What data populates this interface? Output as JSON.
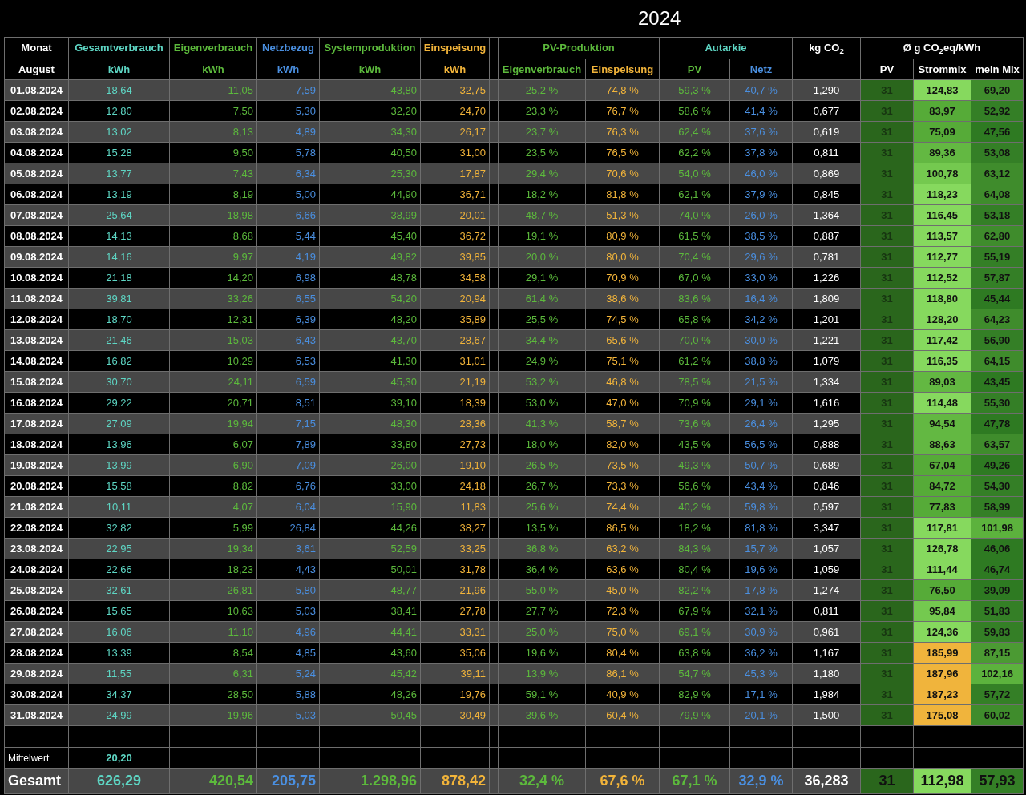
{
  "title": "2024",
  "header": [
    {
      "label": "Monat",
      "color": "#ffffff",
      "kind": "energy",
      "sub": [
        {
          "label": "August",
          "color": "#ffffff"
        }
      ]
    },
    {
      "label": "Gesamtverbrauch",
      "color": "#5ed6c4",
      "kind": "energy",
      "sub": [
        {
          "label": "kWh",
          "color": "#5ed6c4"
        }
      ]
    },
    {
      "label": "Eigenverbrauch",
      "color": "#5cb93c",
      "kind": "energy",
      "sub": [
        {
          "label": "kWh",
          "color": "#5cb93c"
        }
      ]
    },
    {
      "label": "Netzbezug",
      "color": "#4a8fe0",
      "kind": "energy",
      "sub": [
        {
          "label": "kWh",
          "color": "#4a8fe0"
        }
      ]
    },
    {
      "label": "Systemproduktion",
      "color": "#5cb93c",
      "kind": "energy",
      "sub": [
        {
          "label": "kWh",
          "color": "#5cb93c"
        }
      ]
    },
    {
      "label": "Einspeisung",
      "color": "#f2b43a",
      "kind": "energy",
      "sub": [
        {
          "label": "kWh",
          "color": "#f2b43a"
        }
      ]
    },
    {
      "label": "PV-Produktion",
      "color": "#5cb93c",
      "kind": "share",
      "sub": [
        {
          "label": "Eigenverbrauch",
          "color": "#5cb93c"
        },
        {
          "label": "Einspeisung",
          "color": "#f2b43a"
        }
      ]
    },
    {
      "label": "Autarkie",
      "color": "#5ed6c4",
      "kind": "share",
      "sub": [
        {
          "label": "PV",
          "color": "#5cb93c"
        },
        {
          "label": "Netz",
          "color": "#4a8fe0"
        }
      ]
    },
    {
      "label": "kg CO$_{2}$",
      "color": "#ffffff",
      "kind": "co2"
    },
    {
      "label": "Ø g CO$_{2}$eq/kWh",
      "color": "#ffffff",
      "kind": "intensity",
      "sub": [
        {
          "label": "PV",
          "color": "#ffffff"
        },
        {
          "label": "Strommix",
          "color": "#ffffff"
        },
        {
          "label": "mein Mix",
          "color": "#ffffff"
        }
      ]
    }
  ],
  "rows": [
    {
      "date": "01.08.2024",
      "values": [
        "18,64",
        "11,05",
        "7,59",
        "43,80",
        "32,75",
        "25,2 %",
        "74,8 %",
        "59,3 %",
        "40,7 %",
        "1,290"
      ],
      "mix": [
        {
          "text": "31",
          "color": "#2a661c"
        },
        {
          "text": "124,83",
          "color": "#86d95e"
        },
        {
          "text": "69,20",
          "color": "#3f8c2c"
        }
      ]
    },
    {
      "date": "02.08.2024",
      "values": [
        "12,80",
        "7,50",
        "5,30",
        "32,20",
        "24,70",
        "23,3 %",
        "76,7 %",
        "58,6 %",
        "41,4 %",
        "0,677"
      ],
      "mix": [
        {
          "text": "31",
          "color": "#2a661c"
        },
        {
          "text": "83,97",
          "color": "#56ab38"
        },
        {
          "text": "52,92",
          "color": "#347f26"
        }
      ]
    },
    {
      "date": "03.08.2024",
      "values": [
        "13,02",
        "8,13",
        "4,89",
        "34,30",
        "26,17",
        "23,7 %",
        "76,3 %",
        "62,4 %",
        "37,6 %",
        "0,619"
      ],
      "mix": [
        {
          "text": "31",
          "color": "#2a661c"
        },
        {
          "text": "75,09",
          "color": "#56ab38"
        },
        {
          "text": "47,56",
          "color": "#2e7a22"
        }
      ]
    },
    {
      "date": "04.08.2024",
      "values": [
        "15,28",
        "9,50",
        "5,78",
        "40,50",
        "31,00",
        "23,5 %",
        "76,5 %",
        "62,2 %",
        "37,8 %",
        "0,811"
      ],
      "mix": [
        {
          "text": "31",
          "color": "#2a661c"
        },
        {
          "text": "89,36",
          "color": "#63b842"
        },
        {
          "text": "53,08",
          "color": "#347f26"
        }
      ]
    },
    {
      "date": "05.08.2024",
      "values": [
        "13,77",
        "7,43",
        "6,34",
        "25,30",
        "17,87",
        "29,4 %",
        "70,6 %",
        "54,0 %",
        "46,0 %",
        "0,869"
      ],
      "mix": [
        {
          "text": "31",
          "color": "#2a661c"
        },
        {
          "text": "100,78",
          "color": "#74c94f"
        },
        {
          "text": "63,12",
          "color": "#3f8c2c"
        }
      ]
    },
    {
      "date": "06.08.2024",
      "values": [
        "13,19",
        "8,19",
        "5,00",
        "44,90",
        "36,71",
        "18,2 %",
        "81,8 %",
        "62,1 %",
        "37,9 %",
        "0,845"
      ],
      "mix": [
        {
          "text": "31",
          "color": "#2a661c"
        },
        {
          "text": "118,23",
          "color": "#86d95e"
        },
        {
          "text": "64,08",
          "color": "#3f8c2c"
        }
      ]
    },
    {
      "date": "07.08.2024",
      "values": [
        "25,64",
        "18,98",
        "6,66",
        "38,99",
        "20,01",
        "48,7 %",
        "51,3 %",
        "74,0 %",
        "26,0 %",
        "1,364"
      ],
      "mix": [
        {
          "text": "31",
          "color": "#2a661c"
        },
        {
          "text": "116,45",
          "color": "#86d95e"
        },
        {
          "text": "53,18",
          "color": "#347f26"
        }
      ]
    },
    {
      "date": "08.08.2024",
      "values": [
        "14,13",
        "8,68",
        "5,44",
        "45,40",
        "36,72",
        "19,1 %",
        "80,9 %",
        "61,5 %",
        "38,5 %",
        "0,887"
      ],
      "mix": [
        {
          "text": "31",
          "color": "#2a661c"
        },
        {
          "text": "113,57",
          "color": "#86d95e"
        },
        {
          "text": "62,80",
          "color": "#3f8c2c"
        }
      ]
    },
    {
      "date": "09.08.2024",
      "values": [
        "14,16",
        "9,97",
        "4,19",
        "49,82",
        "39,85",
        "20,0 %",
        "80,0 %",
        "70,4 %",
        "29,6 %",
        "0,781"
      ],
      "mix": [
        {
          "text": "31",
          "color": "#2a661c"
        },
        {
          "text": "112,77",
          "color": "#86d95e"
        },
        {
          "text": "55,19",
          "color": "#347f26"
        }
      ]
    },
    {
      "date": "10.08.2024",
      "values": [
        "21,18",
        "14,20",
        "6,98",
        "48,78",
        "34,58",
        "29,1 %",
        "70,9 %",
        "67,0 %",
        "33,0 %",
        "1,226"
      ],
      "mix": [
        {
          "text": "31",
          "color": "#2a661c"
        },
        {
          "text": "112,52",
          "color": "#86d95e"
        },
        {
          "text": "57,87",
          "color": "#347f26"
        }
      ]
    },
    {
      "date": "11.08.2024",
      "values": [
        "39,81",
        "33,26",
        "6,55",
        "54,20",
        "20,94",
        "61,4 %",
        "38,6 %",
        "83,6 %",
        "16,4 %",
        "1,809"
      ],
      "mix": [
        {
          "text": "31",
          "color": "#2a661c"
        },
        {
          "text": "118,80",
          "color": "#86d95e"
        },
        {
          "text": "45,44",
          "color": "#2e7a22"
        }
      ]
    },
    {
      "date": "12.08.2024",
      "values": [
        "18,70",
        "12,31",
        "6,39",
        "48,20",
        "35,89",
        "25,5 %",
        "74,5 %",
        "65,8 %",
        "34,2 %",
        "1,201"
      ],
      "mix": [
        {
          "text": "31",
          "color": "#2a661c"
        },
        {
          "text": "128,20",
          "color": "#86d95e"
        },
        {
          "text": "64,23",
          "color": "#3f8c2c"
        }
      ]
    },
    {
      "date": "13.08.2024",
      "values": [
        "21,46",
        "15,03",
        "6,43",
        "43,70",
        "28,67",
        "34,4 %",
        "65,6 %",
        "70,0 %",
        "30,0 %",
        "1,221"
      ],
      "mix": [
        {
          "text": "31",
          "color": "#2a661c"
        },
        {
          "text": "117,42",
          "color": "#86d95e"
        },
        {
          "text": "56,90",
          "color": "#347f26"
        }
      ]
    },
    {
      "date": "14.08.2024",
      "values": [
        "16,82",
        "10,29",
        "6,53",
        "41,30",
        "31,01",
        "24,9 %",
        "75,1 %",
        "61,2 %",
        "38,8 %",
        "1,079"
      ],
      "mix": [
        {
          "text": "31",
          "color": "#2a661c"
        },
        {
          "text": "116,35",
          "color": "#86d95e"
        },
        {
          "text": "64,15",
          "color": "#3f8c2c"
        }
      ]
    },
    {
      "date": "15.08.2024",
      "values": [
        "30,70",
        "24,11",
        "6,59",
        "45,30",
        "21,19",
        "53,2 %",
        "46,8 %",
        "78,5 %",
        "21,5 %",
        "1,334"
      ],
      "mix": [
        {
          "text": "31",
          "color": "#2a661c"
        },
        {
          "text": "89,03",
          "color": "#63b842"
        },
        {
          "text": "43,45",
          "color": "#2e7a22"
        }
      ]
    },
    {
      "date": "16.08.2024",
      "values": [
        "29,22",
        "20,71",
        "8,51",
        "39,10",
        "18,39",
        "53,0 %",
        "47,0 %",
        "70,9 %",
        "29,1 %",
        "1,616"
      ],
      "mix": [
        {
          "text": "31",
          "color": "#2a661c"
        },
        {
          "text": "114,48",
          "color": "#86d95e"
        },
        {
          "text": "55,30",
          "color": "#347f26"
        }
      ]
    },
    {
      "date": "17.08.2024",
      "values": [
        "27,09",
        "19,94",
        "7,15",
        "48,30",
        "28,36",
        "41,3 %",
        "58,7 %",
        "73,6 %",
        "26,4 %",
        "1,295"
      ],
      "mix": [
        {
          "text": "31",
          "color": "#2a661c"
        },
        {
          "text": "94,54",
          "color": "#63b842"
        },
        {
          "text": "47,78",
          "color": "#2e7a22"
        }
      ]
    },
    {
      "date": "18.08.2024",
      "values": [
        "13,96",
        "6,07",
        "7,89",
        "33,80",
        "27,73",
        "18,0 %",
        "82,0 %",
        "43,5 %",
        "56,5 %",
        "0,888"
      ],
      "mix": [
        {
          "text": "31",
          "color": "#2a661c"
        },
        {
          "text": "88,63",
          "color": "#63b842"
        },
        {
          "text": "63,57",
          "color": "#3f8c2c"
        }
      ]
    },
    {
      "date": "19.08.2024",
      "values": [
        "13,99",
        "6,90",
        "7,09",
        "26,00",
        "19,10",
        "26,5 %",
        "73,5 %",
        "49,3 %",
        "50,7 %",
        "0,689"
      ],
      "mix": [
        {
          "text": "31",
          "color": "#2a661c"
        },
        {
          "text": "67,04",
          "color": "#56ab38"
        },
        {
          "text": "49,26",
          "color": "#2e7a22"
        }
      ]
    },
    {
      "date": "20.08.2024",
      "values": [
        "15,58",
        "8,82",
        "6,76",
        "33,00",
        "24,18",
        "26,7 %",
        "73,3 %",
        "56,6 %",
        "43,4 %",
        "0,846"
      ],
      "mix": [
        {
          "text": "31",
          "color": "#2a661c"
        },
        {
          "text": "84,72",
          "color": "#56ab38"
        },
        {
          "text": "54,30",
          "color": "#347f26"
        }
      ]
    },
    {
      "date": "21.08.2024",
      "values": [
        "10,11",
        "4,07",
        "6,04",
        "15,90",
        "11,83",
        "25,6 %",
        "74,4 %",
        "40,2 %",
        "59,8 %",
        "0,597"
      ],
      "mix": [
        {
          "text": "31",
          "color": "#2a661c"
        },
        {
          "text": "77,83",
          "color": "#56ab38"
        },
        {
          "text": "58,99",
          "color": "#347f26"
        }
      ]
    },
    {
      "date": "22.08.2024",
      "values": [
        "32,82",
        "5,99",
        "26,84",
        "44,26",
        "38,27",
        "13,5 %",
        "86,5 %",
        "18,2 %",
        "81,8 %",
        "3,347"
      ],
      "mix": [
        {
          "text": "31",
          "color": "#2a661c"
        },
        {
          "text": "117,81",
          "color": "#86d95e"
        },
        {
          "text": "101,98",
          "color": "#5cb23d"
        }
      ]
    },
    {
      "date": "23.08.2024",
      "values": [
        "22,95",
        "19,34",
        "3,61",
        "52,59",
        "33,25",
        "36,8 %",
        "63,2 %",
        "84,3 %",
        "15,7 %",
        "1,057"
      ],
      "mix": [
        {
          "text": "31",
          "color": "#2a661c"
        },
        {
          "text": "126,78",
          "color": "#86d95e"
        },
        {
          "text": "46,06",
          "color": "#2e7a22"
        }
      ]
    },
    {
      "date": "24.08.2024",
      "values": [
        "22,66",
        "18,23",
        "4,43",
        "50,01",
        "31,78",
        "36,4 %",
        "63,6 %",
        "80,4 %",
        "19,6 %",
        "1,059"
      ],
      "mix": [
        {
          "text": "31",
          "color": "#2a661c"
        },
        {
          "text": "111,44",
          "color": "#86d95e"
        },
        {
          "text": "46,74",
          "color": "#2e7a22"
        }
      ]
    },
    {
      "date": "25.08.2024",
      "values": [
        "32,61",
        "26,81",
        "5,80",
        "48,77",
        "21,96",
        "55,0 %",
        "45,0 %",
        "82,2 %",
        "17,8 %",
        "1,274"
      ],
      "mix": [
        {
          "text": "31",
          "color": "#2a661c"
        },
        {
          "text": "76,50",
          "color": "#56ab38"
        },
        {
          "text": "39,09",
          "color": "#2e7a22"
        }
      ]
    },
    {
      "date": "26.08.2024",
      "values": [
        "15,65",
        "10,63",
        "5,03",
        "38,41",
        "27,78",
        "27,7 %",
        "72,3 %",
        "67,9 %",
        "32,1 %",
        "0,811"
      ],
      "mix": [
        {
          "text": "31",
          "color": "#2a661c"
        },
        {
          "text": "95,84",
          "color": "#74c94f"
        },
        {
          "text": "51,83",
          "color": "#347f26"
        }
      ]
    },
    {
      "date": "27.08.2024",
      "values": [
        "16,06",
        "11,10",
        "4,96",
        "44,41",
        "33,31",
        "25,0 %",
        "75,0 %",
        "69,1 %",
        "30,9 %",
        "0,961"
      ],
      "mix": [
        {
          "text": "31",
          "color": "#2a661c"
        },
        {
          "text": "124,36",
          "color": "#86d95e"
        },
        {
          "text": "59,83",
          "color": "#347f26"
        }
      ]
    },
    {
      "date": "28.08.2024",
      "values": [
        "13,39",
        "8,54",
        "4,85",
        "43,60",
        "35,06",
        "19,6 %",
        "80,4 %",
        "63,8 %",
        "36,2 %",
        "1,167"
      ],
      "mix": [
        {
          "text": "31",
          "color": "#2a661c"
        },
        {
          "text": "185,99",
          "color": "#f0b43c"
        },
        {
          "text": "87,15",
          "color": "#4b9a33"
        }
      ]
    },
    {
      "date": "29.08.2024",
      "values": [
        "11,55",
        "6,31",
        "5,24",
        "45,42",
        "39,11",
        "13,9 %",
        "86,1 %",
        "54,7 %",
        "45,3 %",
        "1,180"
      ],
      "mix": [
        {
          "text": "31",
          "color": "#2a661c"
        },
        {
          "text": "187,96",
          "color": "#f0b43c"
        },
        {
          "text": "102,16",
          "color": "#5cb23d"
        }
      ]
    },
    {
      "date": "30.08.2024",
      "values": [
        "34,37",
        "28,50",
        "5,88",
        "48,26",
        "19,76",
        "59,1 %",
        "40,9 %",
        "82,9 %",
        "17,1 %",
        "1,984"
      ],
      "mix": [
        {
          "text": "31",
          "color": "#2a661c"
        },
        {
          "text": "187,23",
          "color": "#f0b43c"
        },
        {
          "text": "57,72",
          "color": "#347f26"
        }
      ]
    },
    {
      "date": "31.08.2024",
      "values": [
        "24,99",
        "19,96",
        "5,03",
        "50,45",
        "30,49",
        "39,6 %",
        "60,4 %",
        "79,9 %",
        "20,1 %",
        "1,500"
      ],
      "mix": [
        {
          "text": "31",
          "color": "#2a661c"
        },
        {
          "text": "175,08",
          "color": "#f0b43c"
        },
        {
          "text": "60,02",
          "color": "#3f8c2c"
        }
      ]
    }
  ],
  "average": {
    "label": "Mittelwert",
    "values": [
      "20,20"
    ]
  },
  "total": {
    "label": "Gesamt",
    "values": [
      "626,29",
      "420,54",
      "205,75",
      "1.298,96",
      "878,42",
      "32,4 %",
      "67,6 %",
      "67,1 %",
      "32,9 %",
      "36,283"
    ],
    "mix": [
      {
        "text": "31",
        "color": "#2a661c"
      },
      {
        "text": "112,98",
        "color": "#86d95e"
      },
      {
        "text": "57,93",
        "color": "#347f26"
      }
    ]
  }
}
